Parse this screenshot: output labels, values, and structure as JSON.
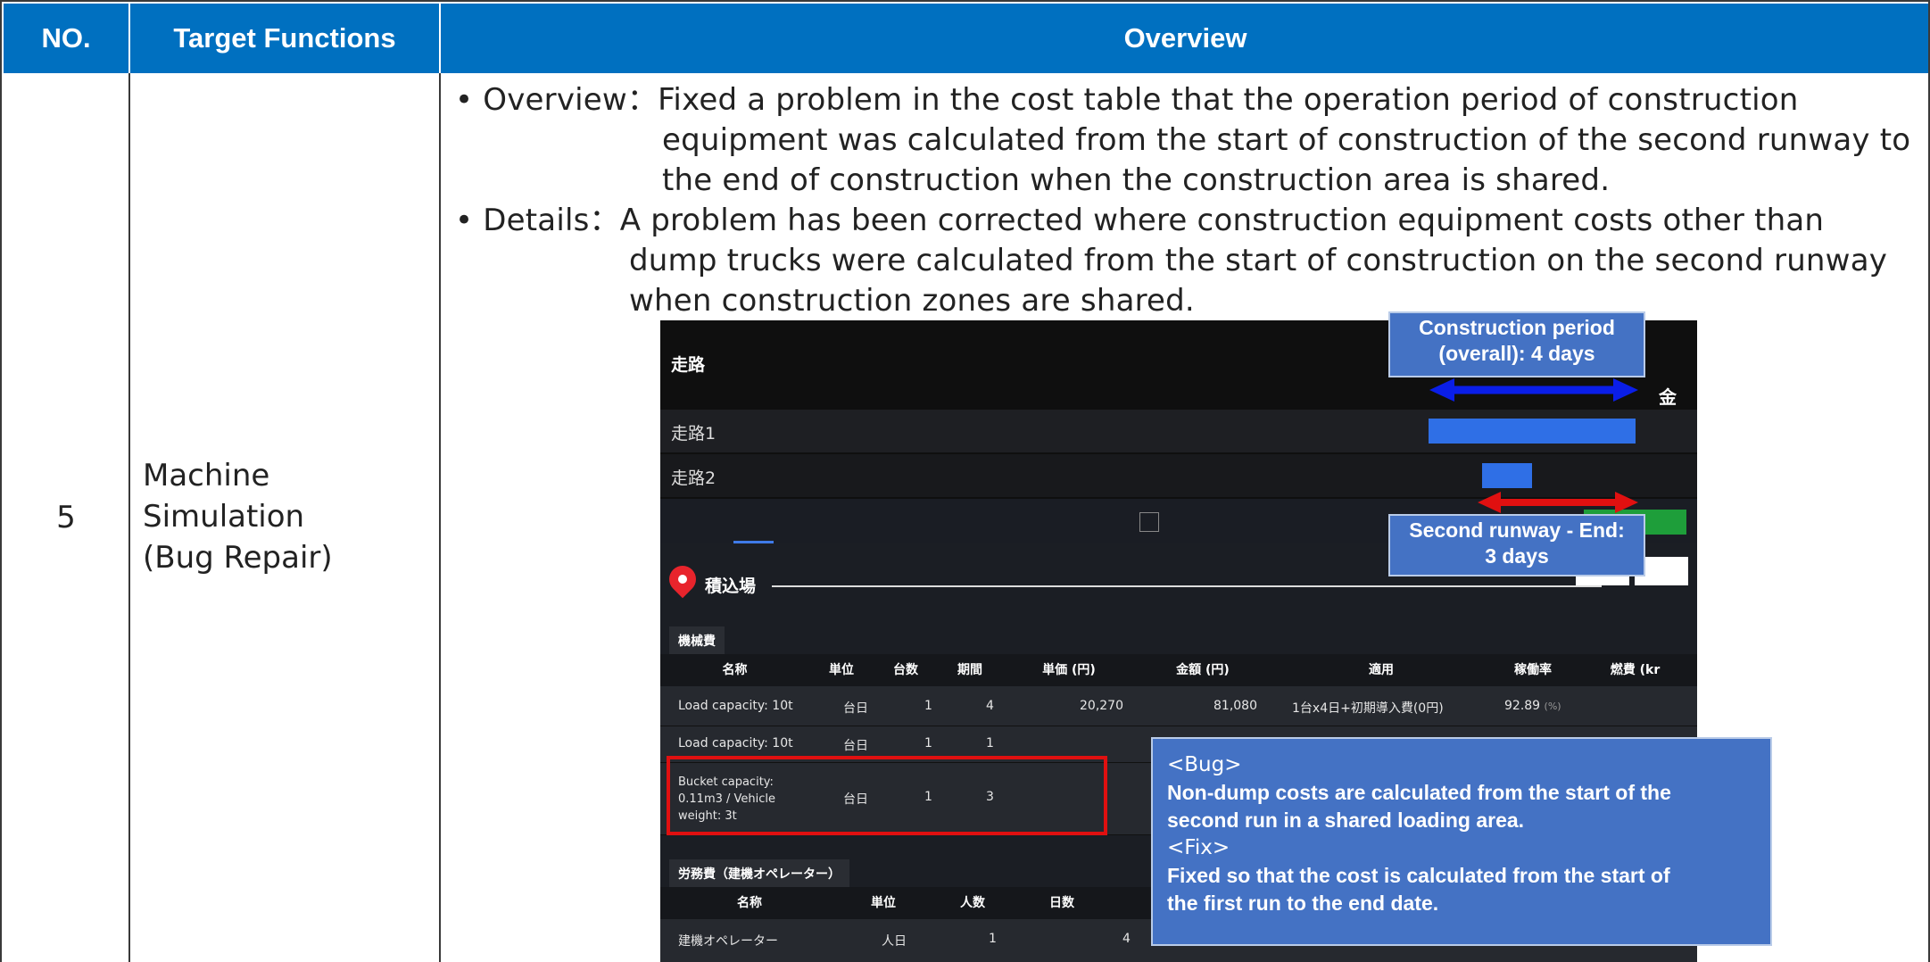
{
  "table": {
    "headers": {
      "no": "NO.",
      "target": "Target Functions",
      "overview": "Overview"
    },
    "row": {
      "no": "5",
      "target_lines": [
        "Machine",
        "Simulation",
        "(Bug Repair)"
      ],
      "overview_lines": [
        "• Overview：Fixed a problem in the cost table that the operation period of construction",
        "equipment was calculated from the start of construction of the second runway to",
        "the end of construction when the construction area is shared.",
        "• Details：A problem has been corrected where construction equipment costs other than",
        "dump trucks were calculated from the start of construction on the second runway",
        "when construction zones are shared."
      ]
    }
  },
  "screenshot": {
    "gantt": {
      "title": "走路",
      "rows": [
        "走路1",
        "走路2"
      ],
      "day_label": "金",
      "bar_color": "#2f6fe6"
    },
    "loading_area": {
      "title": "積込場"
    },
    "machine_badge": "機械費",
    "machine_headers": [
      "名称",
      "単位",
      "台数",
      "期間",
      "単価 (円)",
      "金額 (円)",
      "適用",
      "稼働率",
      "燃費 (kr"
    ],
    "machine_rows": [
      {
        "name": "Load capacity: 10t",
        "unit": "台日",
        "count": "1",
        "period": "4",
        "unit_price": "20,270",
        "amount": "81,080",
        "note": "1台x4日+初期導入費(0円)",
        "rate": "92.89",
        "rate_unit": "(%)"
      },
      {
        "name": "Load capacity: 10t",
        "unit": "台日",
        "count": "1",
        "period": "1"
      },
      {
        "name_lines": [
          "Bucket capacity:",
          "0.11m3 / Vehicle",
          "weight: 3t"
        ],
        "unit": "台日",
        "count": "1",
        "period": "3"
      }
    ],
    "labor_badge": "労務費（建機オペレーター）",
    "labor_headers": [
      "名称",
      "単位",
      "人数",
      "日数"
    ],
    "labor_rows": [
      {
        "name": "建機オペレーター",
        "unit": "人日",
        "count": "1",
        "days": "4"
      }
    ],
    "accent_red": "#e01010"
  },
  "callouts": {
    "period": [
      "Construction period",
      "(overall): 4 days"
    ],
    "second": [
      "Second runway - End:",
      "3 days"
    ],
    "bug_tag": "<Bug>",
    "bug_text": [
      "Non-dump costs are calculated from the start of the",
      "second run in a shared loading area."
    ],
    "fix_tag": "<Fix>",
    "fix_text": [
      "Fixed so that the cost is calculated from the start of",
      "the first run to the end date."
    ]
  }
}
